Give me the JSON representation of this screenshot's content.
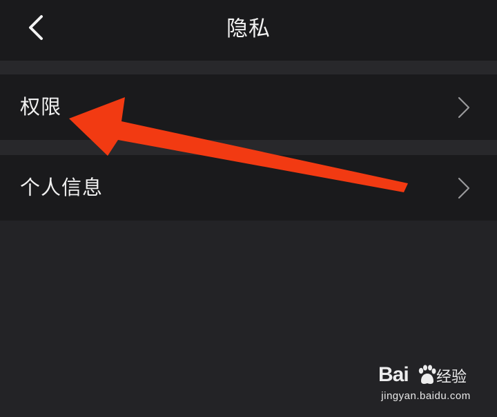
{
  "header": {
    "title": "隐私",
    "back_icon": "chevron-left-icon"
  },
  "menu": {
    "items": [
      {
        "label": "权限",
        "icon": "chevron-right-icon"
      },
      {
        "label": "个人信息",
        "icon": "chevron-right-icon"
      }
    ]
  },
  "annotation": {
    "icon": "red-arrow-icon",
    "color": "#f23a12"
  },
  "watermark": {
    "brand_left": "Bai",
    "brand_right": "经验",
    "url": "jingyan.baidu.com"
  },
  "colors": {
    "background": "#232326",
    "row_background": "#1a1a1c",
    "separator": "#28282b",
    "text": "#f0f0f0",
    "chevron": "#9a9a9c"
  }
}
